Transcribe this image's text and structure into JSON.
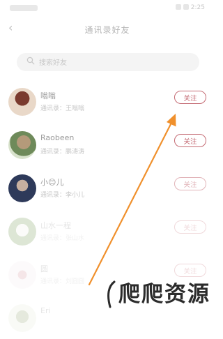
{
  "status_bar": {
    "time": "2:25"
  },
  "header": {
    "title": "通讯录好友"
  },
  "search": {
    "placeholder": "搜索好友"
  },
  "follow_button_label": "关注",
  "contacts": [
    {
      "name": "嗡嗡",
      "meta": "通讯录：王嗡嗡",
      "avatar_color": "#8a4a3c"
    },
    {
      "name": "Raobeen",
      "meta": "通讯录：鹏涛涛",
      "avatar_color": "#9a8a6e"
    },
    {
      "name": "小😊儿",
      "meta": "通讯录：李小儿",
      "avatar_color": "#3a4a6a"
    },
    {
      "name": "山水一程",
      "meta": "通讯录：张山水",
      "avatar_color": "#7aa05a"
    },
    {
      "name": "圆",
      "meta": "通讯录：刘圆圆",
      "avatar_color": "#d9a0a8"
    },
    {
      "name": "Eri",
      "meta": "",
      "avatar_color": "#7a8a5a"
    }
  ],
  "watermark": {
    "text": "爬爬资源"
  },
  "colors": {
    "accent": "#c46a73",
    "arrow": "#f0902c"
  }
}
